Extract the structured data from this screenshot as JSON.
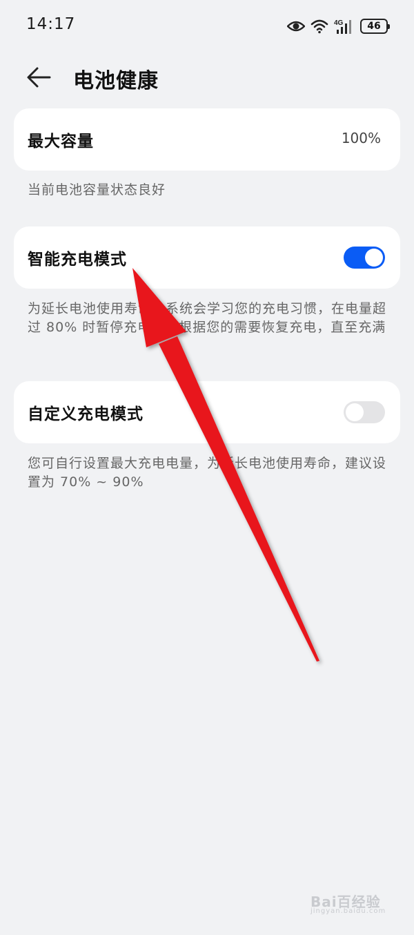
{
  "status_bar": {
    "time": "14:17",
    "network": "4G",
    "battery_level": "46",
    "icons": [
      "eye-icon",
      "wifi-icon",
      "signal-icon",
      "battery-icon"
    ]
  },
  "header": {
    "title": "电池健康",
    "back_icon": "back-arrow-icon"
  },
  "max_capacity": {
    "label": "最大容量",
    "value": "100%",
    "description": "当前电池容量状态良好"
  },
  "smart_charging": {
    "label": "智能充电模式",
    "enabled": true,
    "description": "为延长电池使用寿命，系统会学习您的充电习惯，在电量超过 80% 时暂停充电，并根据您的需要恢复充电，直至充满"
  },
  "custom_charging": {
    "label": "自定义充电模式",
    "enabled": false,
    "description": "您可自行设置最大充电电量，为延长电池使用寿命，建议设置为 70% ~ 90%"
  },
  "colors": {
    "accent": "#0a5cf5",
    "background": "#f1f2f4",
    "annotation_arrow": "#e8141b"
  },
  "watermark": {
    "text": "Bai百经验",
    "sub": "jingyan.baidu.com"
  }
}
